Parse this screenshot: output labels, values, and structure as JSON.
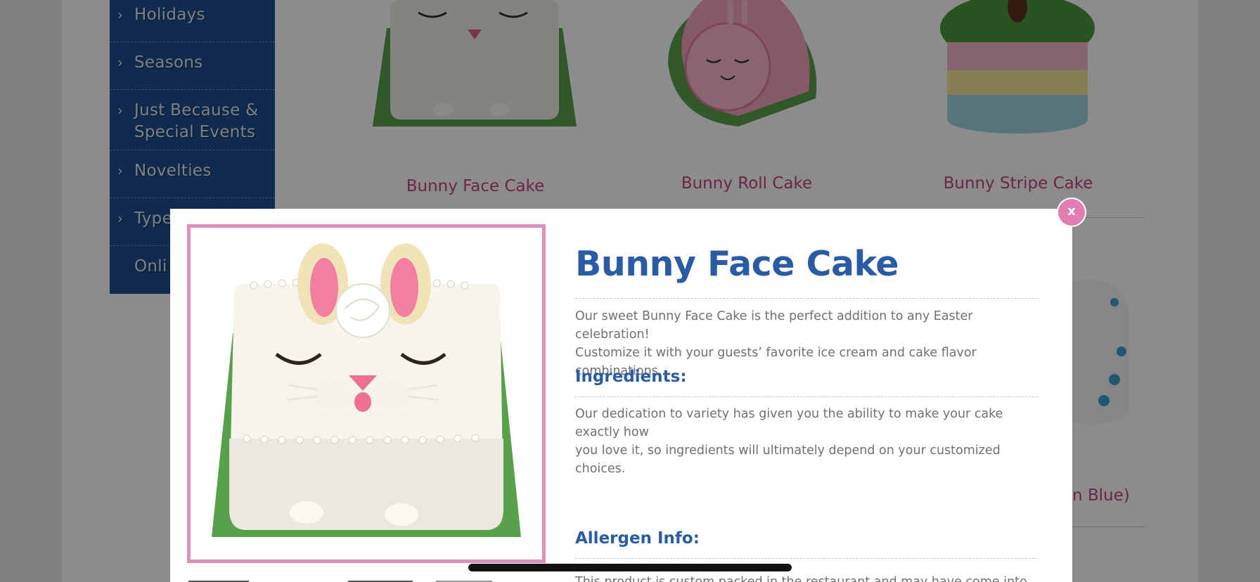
{
  "sidebar": {
    "items": [
      {
        "label": "Holidays"
      },
      {
        "label": "Seasons"
      },
      {
        "label_line1": "Just Because &",
        "label_line2": "Special Events"
      },
      {
        "label": "Novelties"
      },
      {
        "label": "Type"
      },
      {
        "label": "Onli"
      }
    ]
  },
  "products": {
    "row1": [
      "Bunny Face Cake",
      "Bunny Roll Cake",
      "Bunny Stripe Cake"
    ],
    "row2_partial": "n Blue)"
  },
  "modal": {
    "close_label": "x",
    "title": "Bunny Face Cake",
    "description_line1": "Our sweet Bunny Face Cake is the perfect addition to any Easter celebration!",
    "description_line2": "Customize it with your guests’ favorite ice cream and cake flavor combinations.",
    "ingredients_heading": "Ingredients:",
    "ingredients_line1": "Our dedication to variety has given you the ability to make your cake exactly how",
    "ingredients_line2": "you love it, so ingredients will ultimately depend on your customized choices.",
    "allergen_heading": "Allergen Info:",
    "allergen_partial": "This product is custom packed in the restaurant and may have come into contact"
  },
  "colors": {
    "brand_blue": "#2a5ca6",
    "sidebar_blue": "#1f4f8e",
    "pink_accent": "#e08fbd",
    "product_title_pink": "#c4467f"
  }
}
